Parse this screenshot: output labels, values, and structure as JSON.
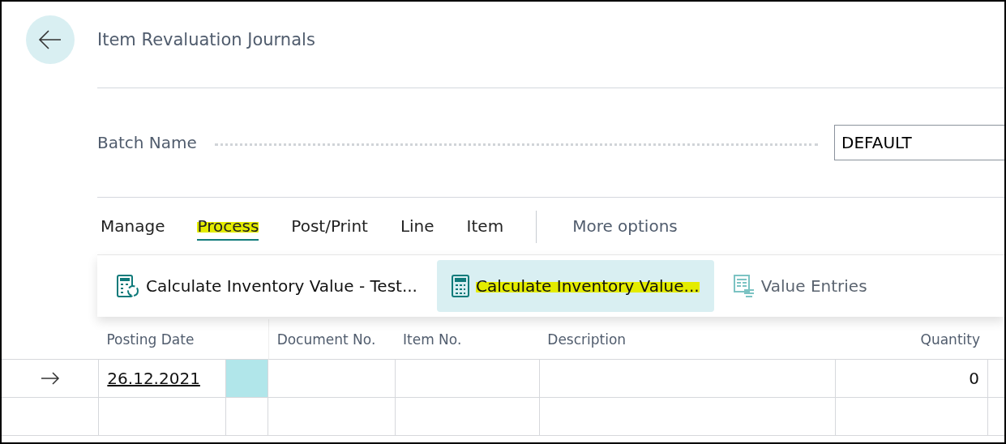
{
  "page": {
    "title": "Item Revaluation Journals"
  },
  "batch_field": {
    "label": "Batch Name",
    "value": "DEFAULT"
  },
  "action_tabs": [
    {
      "label": "Manage",
      "selected": false,
      "highlighted": false
    },
    {
      "label": "Process",
      "selected": true,
      "highlighted": true
    },
    {
      "label": "Post/Print",
      "selected": false,
      "highlighted": false
    },
    {
      "label": "Line",
      "selected": false,
      "highlighted": false
    },
    {
      "label": "Item",
      "selected": false,
      "highlighted": false
    }
  ],
  "more_options": "More options",
  "process_menu": [
    {
      "label": "Calculate Inventory Value - Test...",
      "kind": "calc-refresh",
      "selected": false,
      "highlighted": false,
      "disabled": false
    },
    {
      "label": "Calculate Inventory Value...",
      "kind": "calculator",
      "selected": true,
      "highlighted": true,
      "disabled": false
    },
    {
      "label": "Value Entries",
      "kind": "ledger",
      "selected": false,
      "highlighted": false,
      "disabled": true
    }
  ],
  "table": {
    "columns": [
      {
        "label": "Posting Date"
      },
      {
        "label": "Document No."
      },
      {
        "label": "Item No."
      },
      {
        "label": "Description"
      },
      {
        "label": "Quantity"
      }
    ],
    "rows": [
      {
        "current": true,
        "cells": [
          "26.12.2021",
          "",
          "",
          "",
          "0"
        ]
      },
      {
        "current": false,
        "cells": [
          "",
          "",
          "",
          "",
          ""
        ]
      }
    ]
  }
}
